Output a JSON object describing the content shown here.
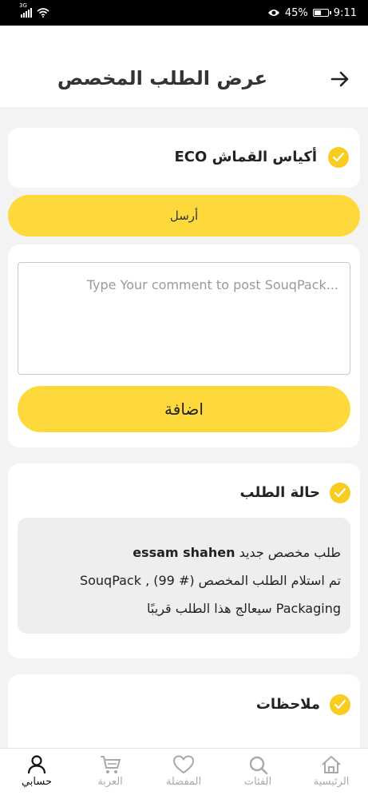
{
  "status_bar": {
    "network": "3G",
    "battery": "45%",
    "time": "9:11"
  },
  "header": {
    "title": "عرض الطلب المخصص"
  },
  "product": {
    "name": "أكياس القماش ECO"
  },
  "send_button": {
    "label": "أرسل"
  },
  "comment": {
    "placeholder": "Type Your comment to post SouqPack...",
    "value": ""
  },
  "add_button": {
    "label": "اضافة"
  },
  "order_status": {
    "title": "حالة الطلب",
    "line1_prefix": "طلب مخصص جديد ",
    "line1_name": "essam  shahen",
    "line2": "تم استلام الطلب المخصص (# 99) , SouqPack",
    "line3": "Packaging سيعالج هذا الطلب قريبًا"
  },
  "notes": {
    "title": "ملاحظات"
  },
  "bottom_nav": {
    "home": "الرئيسية",
    "categories": "الفئات",
    "favorites": "المفضلة",
    "cart": "العربة",
    "account": "حسابي"
  },
  "colors": {
    "accent": "#fdd93b",
    "check": "#f8cc21",
    "background": "#f3f3f4"
  }
}
